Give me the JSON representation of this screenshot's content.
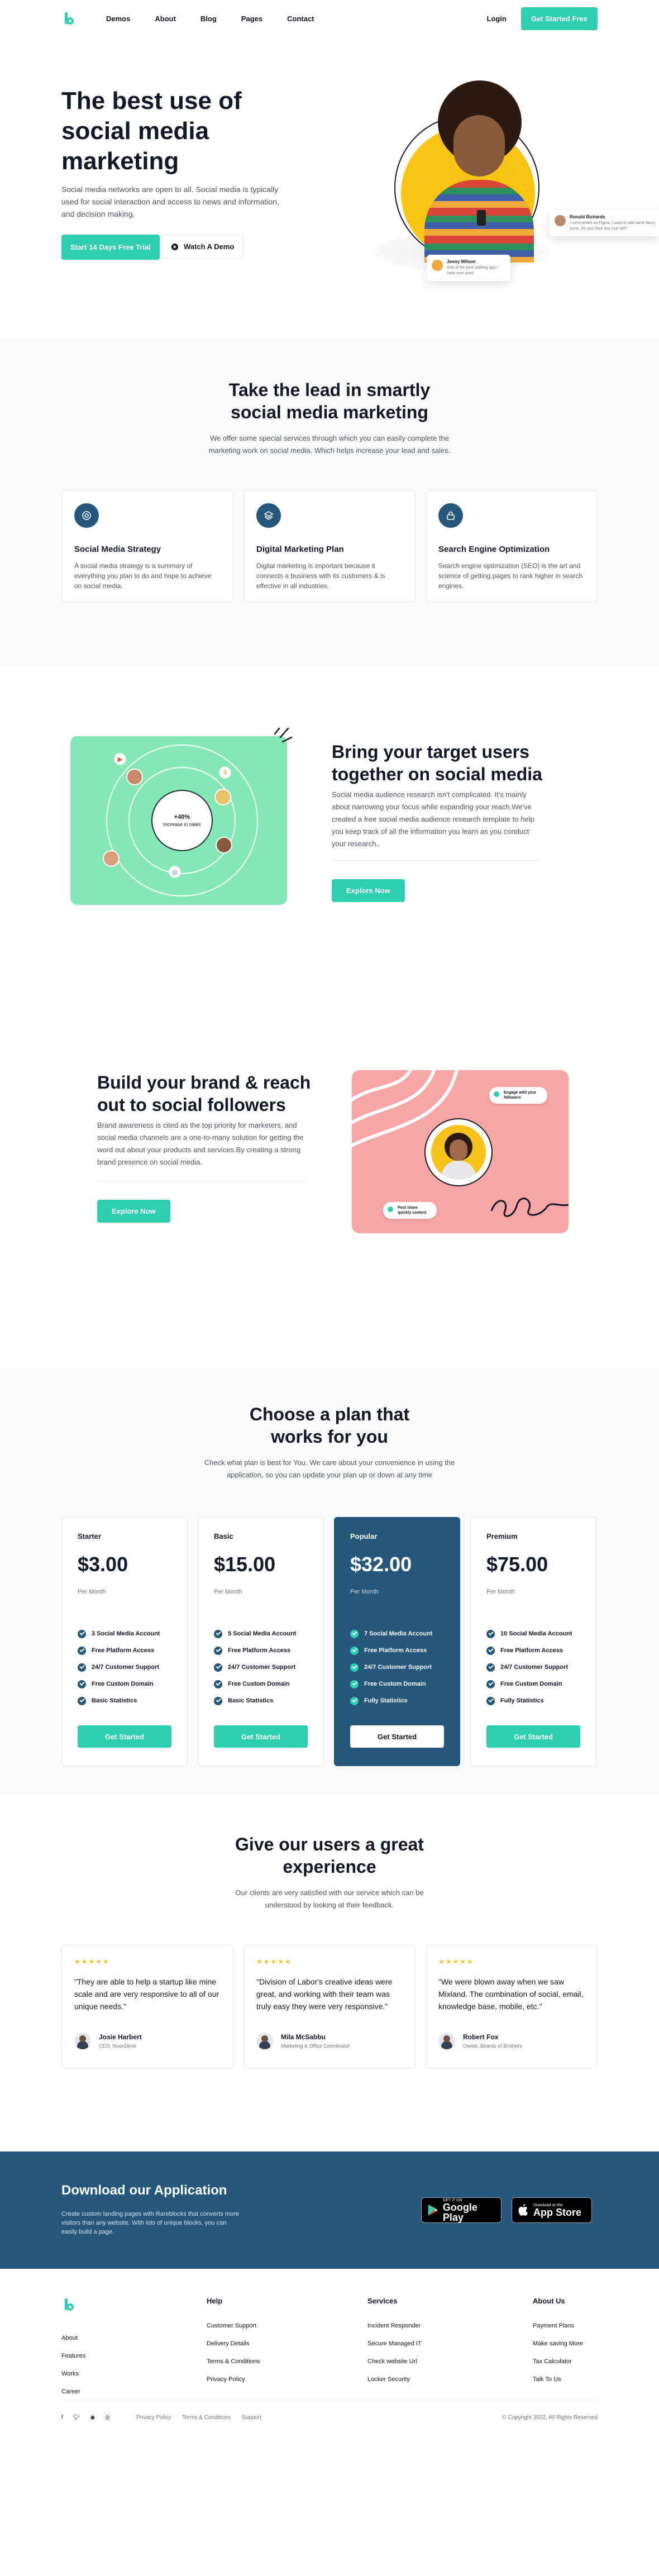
{
  "nav": {
    "links": [
      "Demos",
      "About",
      "Blog",
      "Pages",
      "Contact"
    ],
    "login": "Login",
    "cta": "Get Started Free"
  },
  "hero": {
    "title": "The best use of social media marketing",
    "description": "Social media networks are open to all. Social media is typically used for social interaction and access to news and information, and decision making.",
    "primary_cta": "Start 14 Days Free Trial",
    "secondary_cta": "Watch A Demo",
    "card_ronald": {
      "name": "Ronald Richards",
      "text": "I commented on Figma, I want to add some fancy icons. Do you have any icon set?"
    },
    "card_jenny": {
      "name": "Jenny Wilson",
      "text": "One of the best clothing app I have ever used"
    }
  },
  "services": {
    "title": "Take the lead in smartly social media marketing",
    "subtitle": "We offer some special services through which you can easily complete the marketing work on social media. Which helps increase your lead and sales.",
    "items": [
      {
        "icon": "target-icon",
        "title": "Social Media Strategy",
        "text": "A social media strategy is a summary of everything you plan to do and hope to achieve on social media."
      },
      {
        "icon": "layers-icon",
        "title": "Digital Marketing Plan",
        "text": "Digital marketing is important because it connects a business with its customers & is effective in all industries."
      },
      {
        "icon": "lock-icon",
        "title": "Search Engine Optimization",
        "text": "Search engine optimization (SEO) is the art and science of getting pages to rank higher in search engines."
      }
    ]
  },
  "target": {
    "badge_value": "+40%",
    "badge_label": "Increase in sales",
    "title": "Bring your target users together on social media",
    "text": "Social media audience research isn't complicated. It's mainly about narrowing your focus while expanding your reach.We've created a free social media audience research template to help you keep track of all the information you learn as you conduct your research..",
    "cta": "Explore Now"
  },
  "brand": {
    "title": "Build your brand & reach out to social followers",
    "text": "Brand awareness is cited as the top priority for marketers, and social media channels are a one-to-many solution for getting the word out about your products and services.By creating a strong brand presence on social media.",
    "cta": "Explore Now",
    "pill_top": "Engage with your followers",
    "pill_bottom": "Post share quickly content"
  },
  "pricing": {
    "title": "Choose a plan that works for you",
    "subtitle": "Check what plan is best for You. We care about your convenience in using the application, so you can update your plan up or down at any time",
    "plans": [
      {
        "name": "Starter",
        "price": "$3.00",
        "period": "Per Month",
        "features": [
          "3 Social Media Account",
          "Free Platform Access",
          "24/7 Customer Support",
          "Free Custom Domain",
          "Basic Statistics"
        ],
        "cta": "Get Started"
      },
      {
        "name": "Basic",
        "price": "$15.00",
        "period": "Per Month",
        "features": [
          "5 Social Media Account",
          "Free Platform Access",
          "24/7 Customer Support",
          "Free Custom Domain",
          "Basic Statistics"
        ],
        "cta": "Get Started"
      },
      {
        "name": "Popular",
        "price": "$32.00",
        "period": "Per Month",
        "features": [
          "7 Social Media Account",
          "Free Platform Access",
          "24/7 Customer Support",
          "Free Custom Domain",
          "Fully Statistics"
        ],
        "cta": "Get Started"
      },
      {
        "name": "Premium",
        "price": "$75.00",
        "period": "Per Month",
        "features": [
          "10 Social Media Account",
          "Free Platform Access",
          "24/7 Customer Support",
          "Free Custom Domain",
          "Fully Statistics"
        ],
        "cta": "Get Started"
      }
    ]
  },
  "testimonials": {
    "title": "Give our users a great experience",
    "subtitle": "Our clients are very satisfied with our service which can be understood by looking at their feedback.",
    "stars": "★★★★★",
    "items": [
      {
        "quote": "\"They are able to help a startup like mine scale and are very responsive to all of our unique needs.\"",
        "name": "Josie Harbert",
        "role": "CEO, NoonDime"
      },
      {
        "quote": "\"Division of Labor's creative ideas were great, and working with their team was truly easy they were very responsive.\"",
        "name": "Mila McSabbu",
        "role": "Marketing & Office Coordinator"
      },
      {
        "quote": "\"We were blown away when we saw Mixland. The combination of social, email, knowledge base, mobile, etc.\"",
        "name": "Robert Fox",
        "role": "Owner, Beards of Brothers"
      }
    ]
  },
  "app": {
    "title": "Download our Application",
    "text": "Create custom landing pages with Rareblocks that converts more visitors than any website. With lots of unique blocks, you can easily build a page.",
    "google_small": "GET IT ON",
    "google_big": "Google Play",
    "apple_small": "Download on the",
    "apple_big": "App Store"
  },
  "footer": {
    "col1": [
      "About",
      "Features",
      "Works",
      "Career"
    ],
    "help_title": "Help",
    "help": [
      "Customer Support",
      "Delivery Details",
      "Terms & Conditions",
      "Privacy Policy"
    ],
    "services_title": "Services",
    "services": [
      "Incident Responder",
      "Secure Managed IT",
      "Check website Url",
      "Locker Security"
    ],
    "about_title": "About Us",
    "about": [
      "Payment Plans",
      "Make saving More",
      "Tax Calculator",
      "Talk To Us"
    ],
    "bottom_links": [
      "Privacy Policy",
      "Terms & Conditions",
      "Support"
    ],
    "copyright": "© Copyright 2022, All Rights Reserved"
  },
  "colors": {
    "accent": "#2dcfb0",
    "navy": "#25577d",
    "mint": "#83e8b5",
    "pink": "#f7a5a5",
    "yellow": "#f9c413"
  }
}
